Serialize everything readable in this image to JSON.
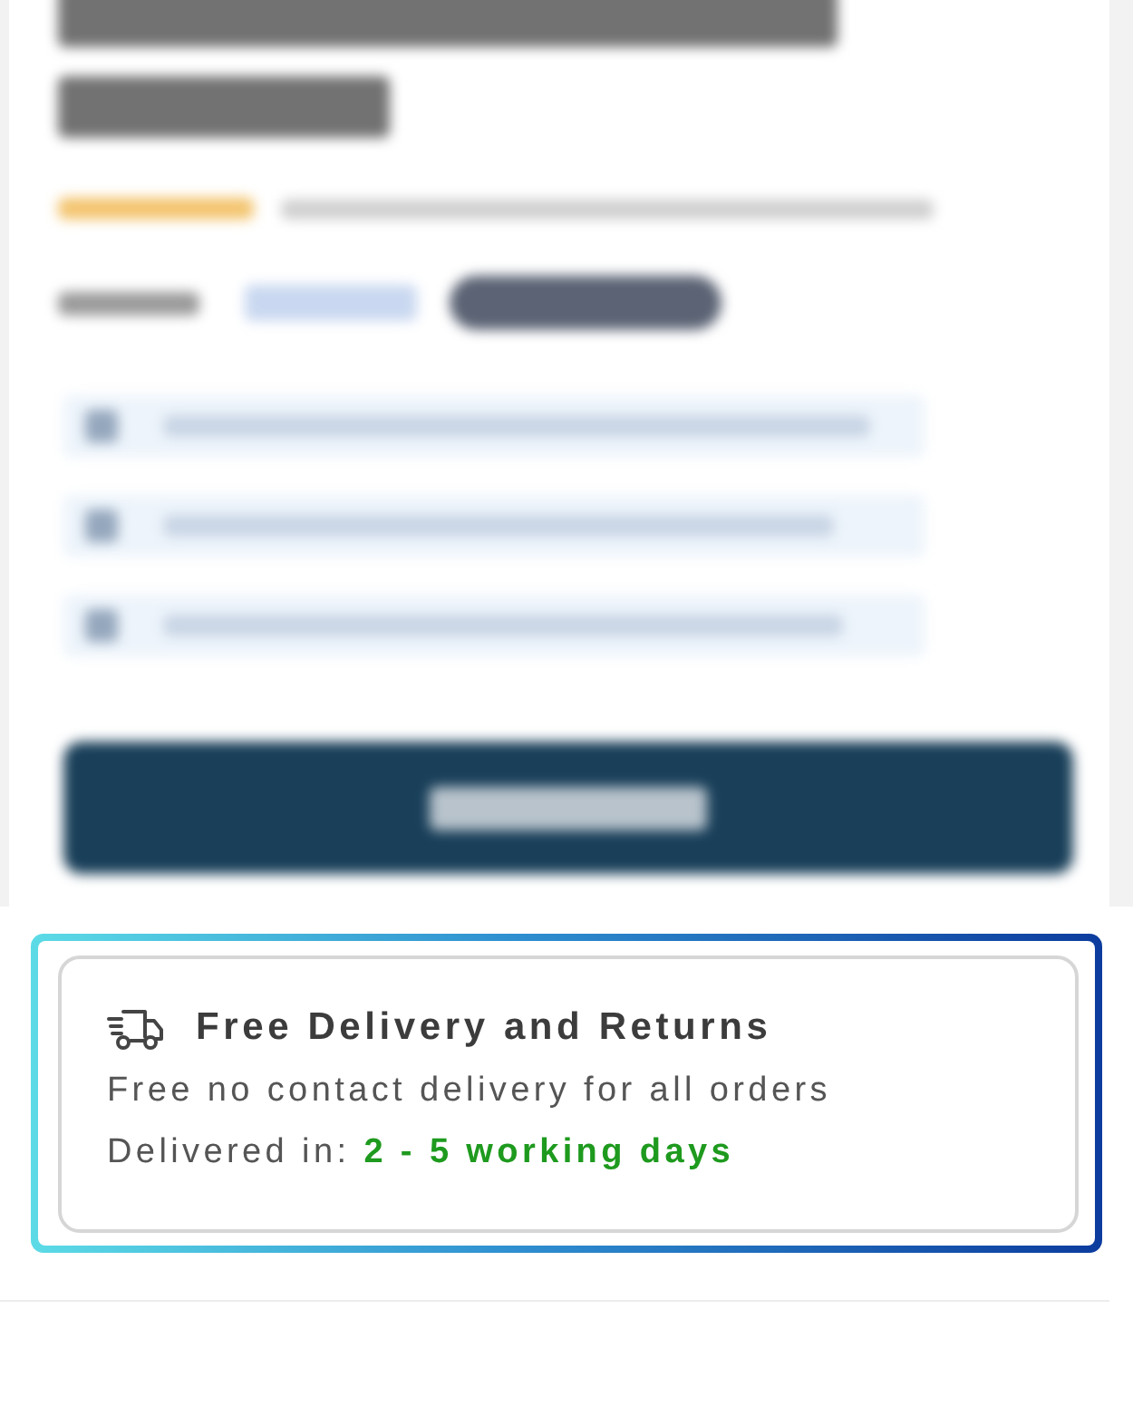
{
  "delivery": {
    "title": "Free Delivery and Returns",
    "description": "Free no contact delivery for all orders",
    "eta": "Delivered in: **2 - 5 working days**"
  }
}
